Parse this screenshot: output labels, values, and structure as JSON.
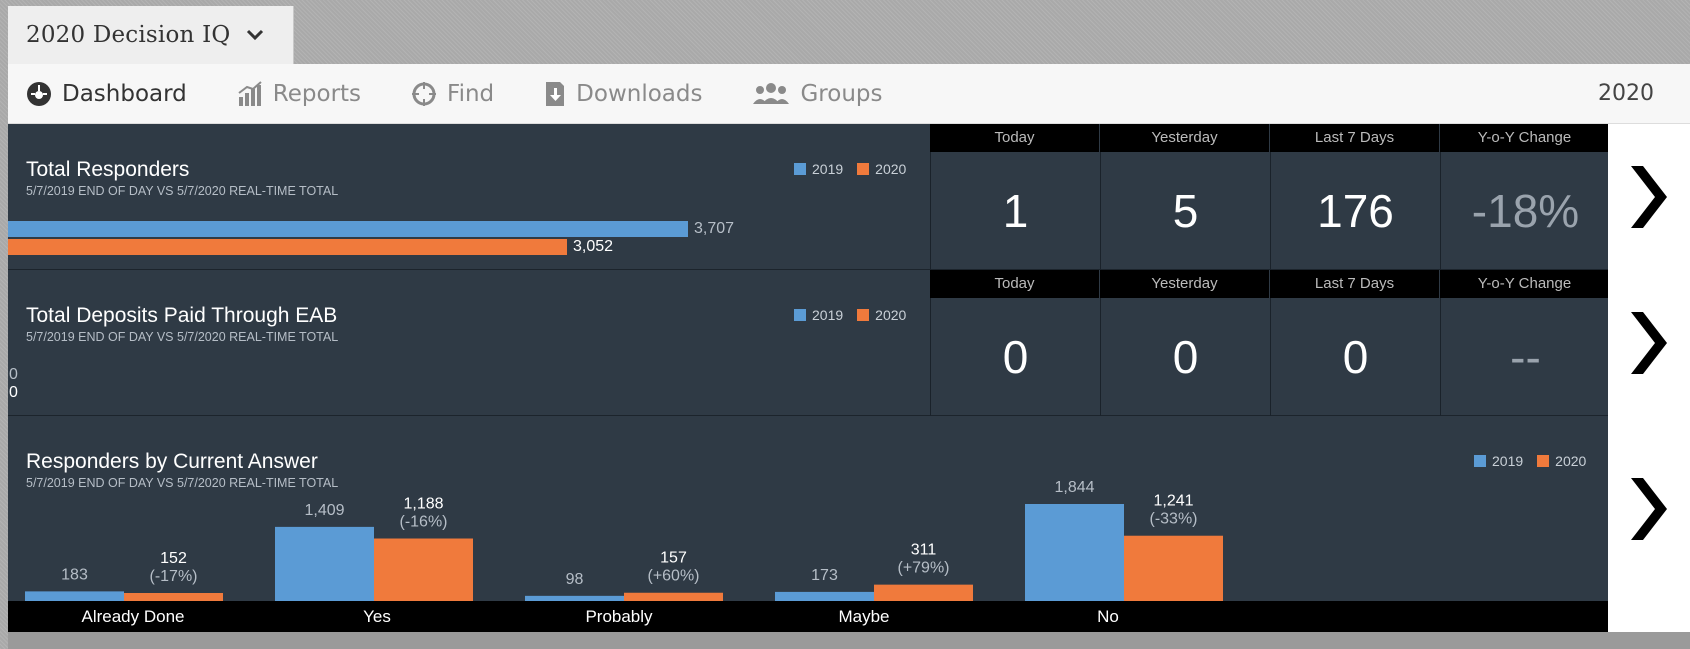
{
  "app_title": "2020 Decision IQ",
  "nav": {
    "items": [
      {
        "label": "Dashboard",
        "icon": "dashboard-icon"
      },
      {
        "label": "Reports",
        "icon": "reports-icon"
      },
      {
        "label": "Find",
        "icon": "find-icon"
      },
      {
        "label": "Downloads",
        "icon": "downloads-icon"
      },
      {
        "label": "Groups",
        "icon": "groups-icon"
      }
    ],
    "year": "2020"
  },
  "colors": {
    "series_2019": "#5b9bd5",
    "series_2020": "#f07a3c"
  },
  "stat_headers": [
    "Today",
    "Yesterday",
    "Last 7 Days",
    "Y-o-Y Change"
  ],
  "panels": {
    "total_responders": {
      "title": "Total Responders",
      "subtitle": "5/7/2019 END OF DAY VS 5/7/2020 REAL-TIME TOTAL",
      "legend": [
        "2019",
        "2020"
      ],
      "values": {
        "y2019": "3,707",
        "y2020": "3,052"
      },
      "stats": {
        "today": "1",
        "yesterday": "5",
        "last7": "176",
        "yoy": "-18%"
      }
    },
    "total_deposits": {
      "title": "Total Deposits Paid Through EAB",
      "subtitle": "5/7/2019 END OF DAY VS 5/7/2020 REAL-TIME TOTAL",
      "legend": [
        "2019",
        "2020"
      ],
      "values": {
        "y2019": "0",
        "y2020": "0"
      },
      "stats": {
        "today": "0",
        "yesterday": "0",
        "last7": "0",
        "yoy": "--"
      }
    },
    "by_answer": {
      "title": "Responders by Current Answer",
      "subtitle": "5/7/2019 END OF DAY VS 5/7/2020 REAL-TIME TOTAL",
      "legend": [
        "2019",
        "2020"
      ]
    }
  },
  "chart_data": {
    "type": "bar",
    "title": "Responders by Current Answer",
    "categories": [
      "Already Done",
      "Yes",
      "Probably",
      "Maybe",
      "No"
    ],
    "series": [
      {
        "name": "2019",
        "values": [
          183,
          1409,
          98,
          173,
          1844
        ]
      },
      {
        "name": "2020",
        "values": [
          152,
          1188,
          157,
          311,
          1241
        ]
      }
    ],
    "labels_2019": [
      "183",
      "1,409",
      "98",
      "173",
      "1,844"
    ],
    "labels_2020": [
      "152",
      "1,188",
      "157",
      "311",
      "1,241"
    ],
    "changes": [
      "(-17%)",
      "(-16%)",
      "(+60%)",
      "(+79%)",
      "(-33%)"
    ]
  }
}
